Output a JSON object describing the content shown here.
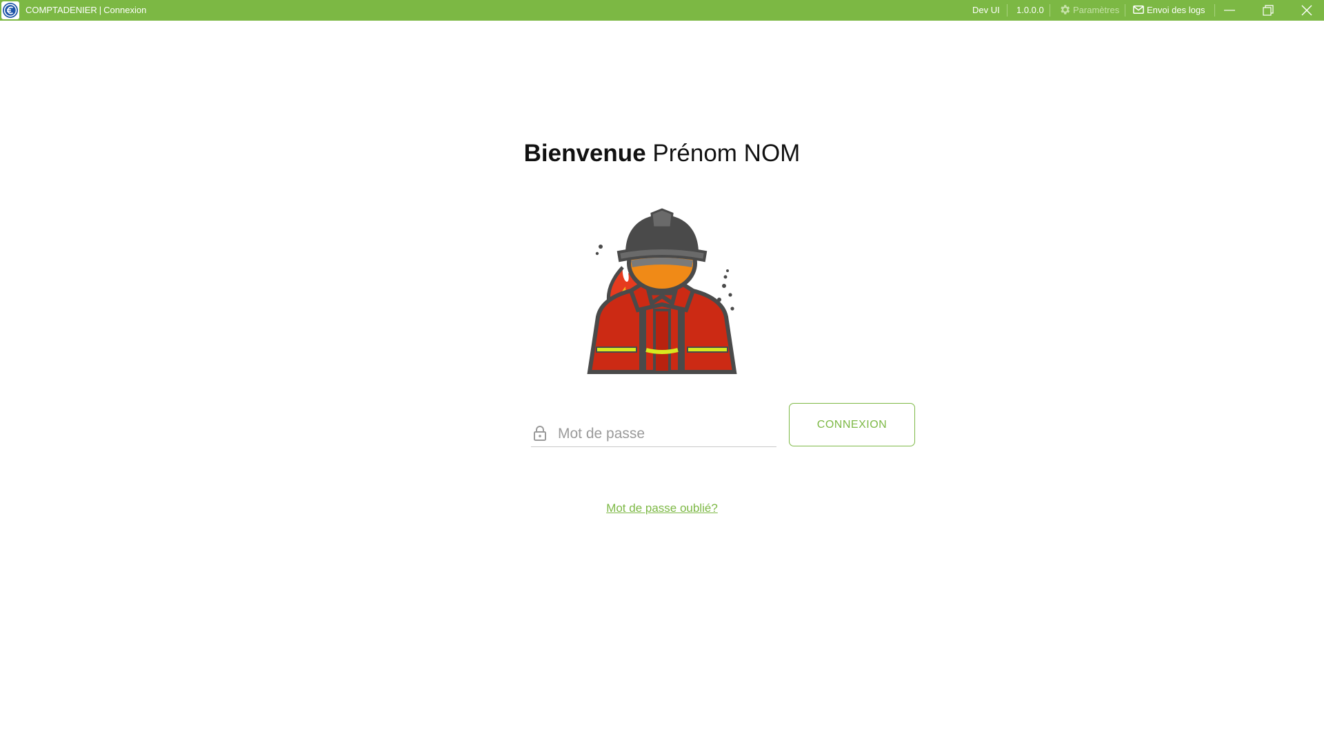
{
  "window": {
    "app_name": "COMPTADENIER",
    "separator": "|",
    "page_name": "Connexion",
    "env_label": "Dev UI",
    "version": "1.0.0.0",
    "settings_label": "Paramètres",
    "send_logs_label": "Envoi des logs",
    "settings_disabled": true
  },
  "login": {
    "welcome_bold": "Bienvenue",
    "user_name": "Prénom NOM",
    "avatar_icon": "firefighter-icon",
    "password_placeholder": "Mot de passe",
    "password_value": "",
    "connect_label": "CONNEXION",
    "forgot_label": "Mot de passe oublié?"
  },
  "colors": {
    "accent": "#7cb844",
    "title_bar": "#7cb844",
    "logo_blue": "#1f55a8"
  },
  "icons": {
    "app_logo": "euro-logo-icon",
    "settings": "gear-icon",
    "send_logs": "envelope-icon",
    "minimize": "minimize-icon",
    "restore": "restore-icon",
    "close": "close-icon",
    "password": "lock-icon"
  }
}
